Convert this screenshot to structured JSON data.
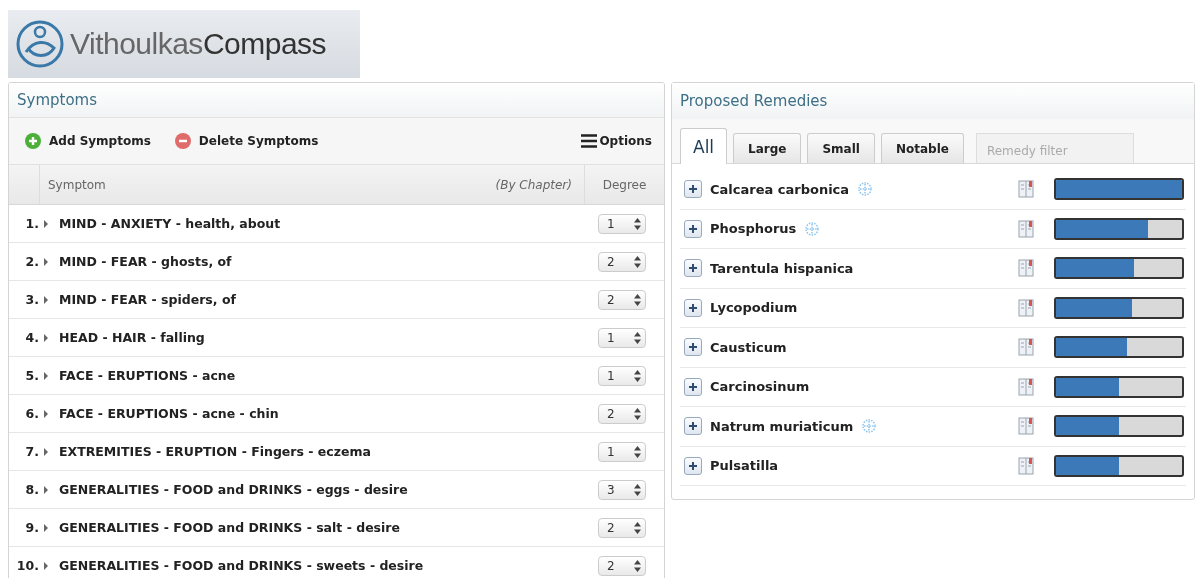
{
  "logo": {
    "light": "Vithoulkas",
    "bold": "Compass"
  },
  "symptoms": {
    "title": "Symptoms",
    "toolbar": [
      {
        "kind": "add",
        "label": "Add Symptoms"
      },
      {
        "kind": "delete",
        "label": "Delete Symptoms"
      },
      {
        "kind": "options",
        "label": "Options"
      }
    ],
    "columns": {
      "symptom": "Symptom",
      "hint": "(By Chapter)",
      "degree": "Degree"
    },
    "rows": [
      {
        "number": "1.",
        "text": "MIND - ANXIETY - health, about",
        "degree": "1"
      },
      {
        "number": "2.",
        "text": "MIND - FEAR - ghosts, of",
        "degree": "2"
      },
      {
        "number": "3.",
        "text": "MIND - FEAR - spiders, of",
        "degree": "2"
      },
      {
        "number": "4.",
        "text": "HEAD - HAIR - falling",
        "degree": "1"
      },
      {
        "number": "5.",
        "text": "FACE - ERUPTIONS - acne",
        "degree": "1"
      },
      {
        "number": "6.",
        "text": "FACE - ERUPTIONS - acne - chin",
        "degree": "2"
      },
      {
        "number": "7.",
        "text": "EXTREMITIES - ERUPTION - Fingers - eczema",
        "degree": "1"
      },
      {
        "number": "8.",
        "text": "GENERALITIES - FOOD and DRINKS - eggs - desire",
        "degree": "3"
      },
      {
        "number": "9.",
        "text": "GENERALITIES - FOOD and DRINKS - salt - desire",
        "degree": "2"
      },
      {
        "number": "10.",
        "text": "GENERALITIES - FOOD and DRINKS - sweets - desire",
        "degree": "2"
      }
    ]
  },
  "remedies": {
    "title": "Proposed Remedies",
    "tabs": [
      {
        "label": "All",
        "selected": true
      },
      {
        "label": "Large",
        "selected": false
      },
      {
        "label": "Small",
        "selected": false
      },
      {
        "label": "Notable",
        "selected": false
      }
    ],
    "filter": {
      "placeholder": "Remedy filter"
    },
    "items": [
      {
        "name": "Calcarea carbonica",
        "flagged": true,
        "level": 1.0
      },
      {
        "name": "Phosphorus",
        "flagged": true,
        "level": 0.73
      },
      {
        "name": "Tarentula hispanica",
        "flagged": false,
        "level": 0.62
      },
      {
        "name": "Lycopodium",
        "flagged": false,
        "level": 0.6
      },
      {
        "name": "Causticum",
        "flagged": false,
        "level": 0.56
      },
      {
        "name": "Carcinosinum",
        "flagged": false,
        "level": 0.5
      },
      {
        "name": "Natrum muriaticum",
        "flagged": true,
        "level": 0.5
      },
      {
        "name": "Pulsatilla",
        "flagged": false,
        "level": 0.5
      }
    ]
  }
}
